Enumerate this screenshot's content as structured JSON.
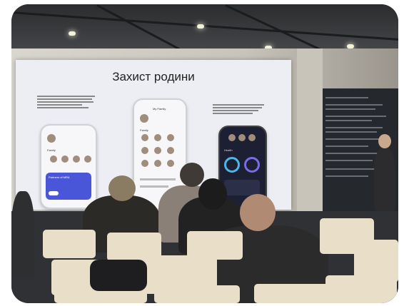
{
  "slide": {
    "title": "Захист родини",
    "phone_labels": {
      "family": "Family",
      "partners": "Partners of MRA",
      "my_family": "My Family",
      "health": "Health"
    }
  },
  "colors": {
    "screen_bg": "#eceef4",
    "accent_blue": "#4a56d8",
    "dark_phone": "#1d2033",
    "chair": "#e9dfc8"
  }
}
